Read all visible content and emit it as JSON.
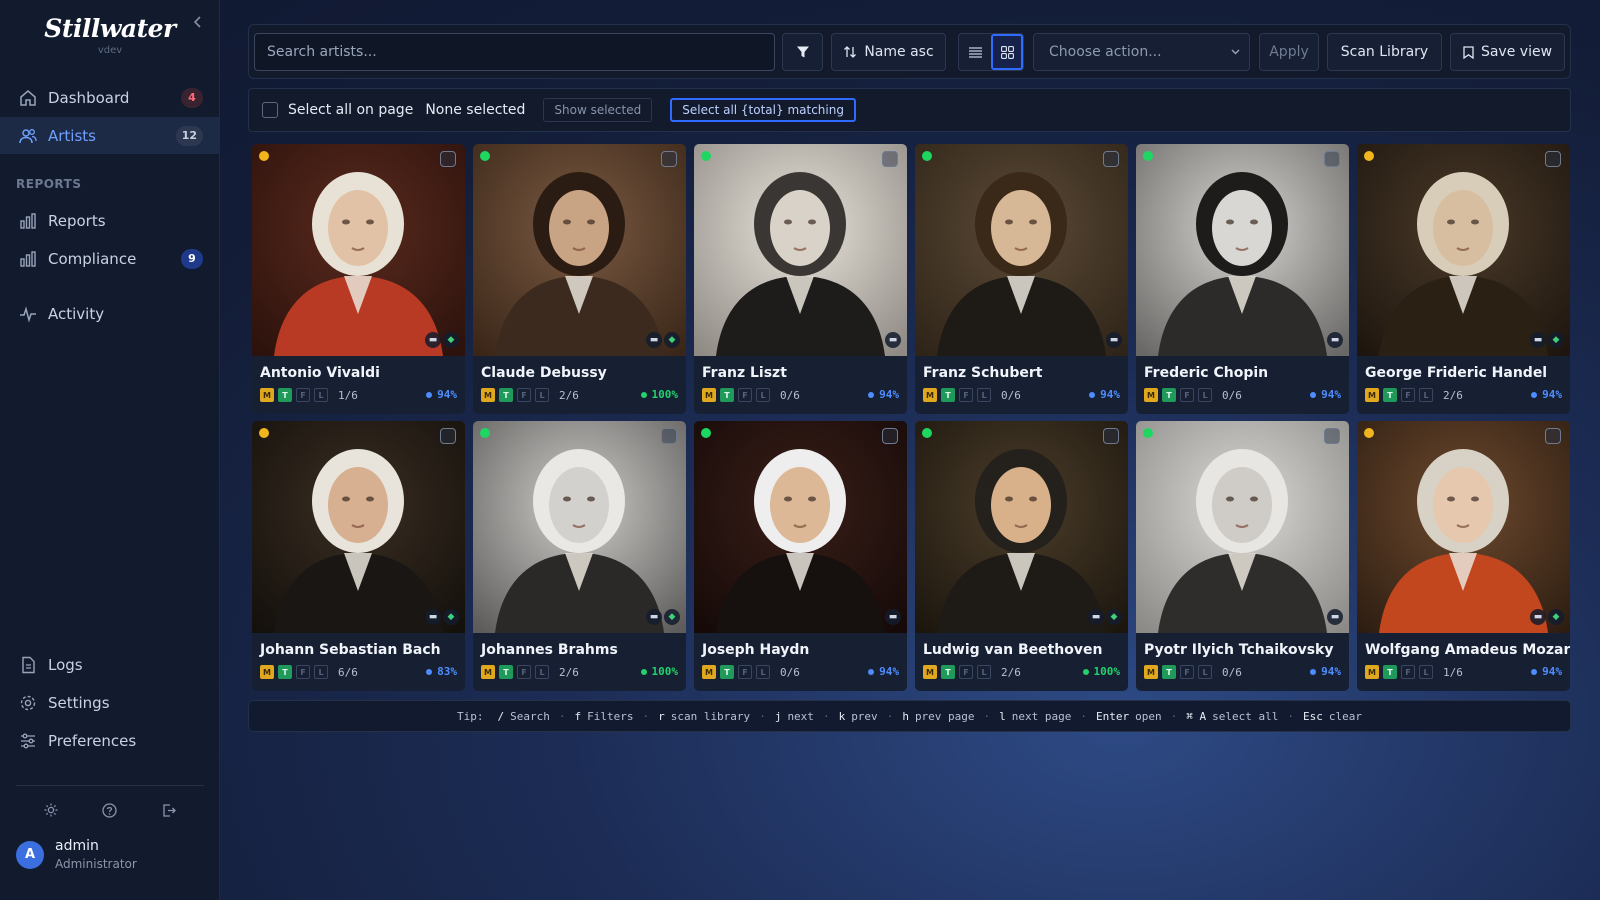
{
  "brand": {
    "name": "Stillwater",
    "sub": "vdev"
  },
  "nav": {
    "items": [
      {
        "label": "Dashboard",
        "badge": "4"
      },
      {
        "label": "Artists",
        "badge": "12"
      }
    ],
    "section": "REPORTS",
    "reports": [
      {
        "label": "Reports"
      },
      {
        "label": "Compliance",
        "badge": "9"
      },
      {
        "label": "Activity"
      }
    ],
    "bottom": [
      {
        "label": "Logs"
      },
      {
        "label": "Settings"
      },
      {
        "label": "Preferences"
      }
    ]
  },
  "user": {
    "initial": "A",
    "name": "admin",
    "role": "Administrator"
  },
  "toolbar": {
    "search_placeholder": "Search artists...",
    "sort_label": "Name asc",
    "action_placeholder": "Choose action...",
    "apply_label": "Apply",
    "scan_label": "Scan Library",
    "save_label": "Save view",
    "view_mode": "grid"
  },
  "selection": {
    "select_all_label": "Select all on page",
    "status": "None selected",
    "show_selected": "Show selected",
    "select_all_matching": "Select all {total} matching"
  },
  "colors": {
    "accent": "#2f6bff",
    "yellow": "#f2b51e",
    "green": "#1ed760"
  },
  "artists": [
    {
      "name": "Antonio Vivaldi",
      "status": "yellow",
      "count": "1/6",
      "pct": "94%",
      "pct_color": "blue",
      "icons": 2
    },
    {
      "name": "Claude Debussy",
      "status": "green",
      "count": "2/6",
      "pct": "100%",
      "pct_color": "green",
      "icons": 2
    },
    {
      "name": "Franz Liszt",
      "status": "green",
      "count": "0/6",
      "pct": "94%",
      "pct_color": "blue",
      "icons": 1
    },
    {
      "name": "Franz Schubert",
      "status": "green",
      "count": "0/6",
      "pct": "94%",
      "pct_color": "blue",
      "icons": 1
    },
    {
      "name": "Frederic Chopin",
      "status": "green",
      "count": "0/6",
      "pct": "94%",
      "pct_color": "blue",
      "icons": 1
    },
    {
      "name": "George Frideric Handel",
      "status": "yellow",
      "count": "2/6",
      "pct": "94%",
      "pct_color": "blue",
      "icons": 2
    },
    {
      "name": "Johann Sebastian Bach",
      "status": "yellow",
      "count": "6/6",
      "pct": "83%",
      "pct_color": "blue",
      "icons": 2
    },
    {
      "name": "Johannes Brahms",
      "status": "green",
      "count": "2/6",
      "pct": "100%",
      "pct_color": "green",
      "icons": 2
    },
    {
      "name": "Joseph Haydn",
      "status": "green",
      "count": "0/6",
      "pct": "94%",
      "pct_color": "blue",
      "icons": 1
    },
    {
      "name": "Ludwig van Beethoven",
      "status": "green",
      "count": "2/6",
      "pct": "100%",
      "pct_color": "green",
      "icons": 2
    },
    {
      "name": "Pyotr Ilyich Tchaikovsky",
      "status": "green",
      "count": "0/6",
      "pct": "94%",
      "pct_color": "blue",
      "icons": 1
    },
    {
      "name": "Wolfgang Amadeus Mozart",
      "status": "yellow",
      "count": "1/6",
      "pct": "94%",
      "pct_color": "blue",
      "icons": 2
    }
  ],
  "tips": {
    "label": "Tip:",
    "items": [
      {
        "key": "/",
        "label": "Search"
      },
      {
        "key": "f",
        "label": "Filters"
      },
      {
        "key": "r",
        "label": "scan library"
      },
      {
        "key": "j",
        "label": "next"
      },
      {
        "key": "k",
        "label": "prev"
      },
      {
        "key": "h",
        "label": "prev page"
      },
      {
        "key": "l",
        "label": "next page"
      },
      {
        "key": "Enter",
        "label": "open"
      },
      {
        "key": "⌘ A",
        "label": "select all"
      },
      {
        "key": "Esc",
        "label": "clear"
      }
    ]
  }
}
